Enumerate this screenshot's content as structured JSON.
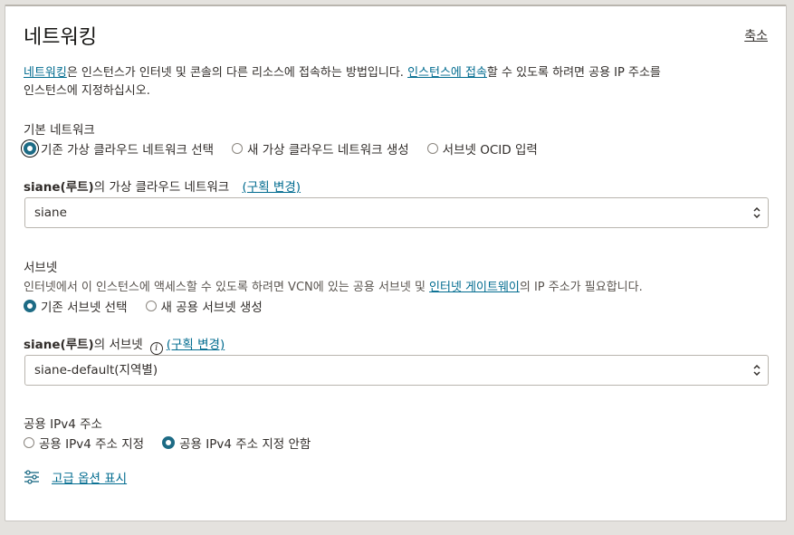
{
  "header": {
    "title": "네트워킹",
    "collapse_label": "축소"
  },
  "intro": {
    "link1": "네트워킹",
    "text1": "은 인스턴스가 인터넷 및 콘솔의 다른 리소스에 접속하는 방법입니다. ",
    "link2": "인스턴스에 접속",
    "text2": "할 수 있도록 하려면 공용 IP 주소를",
    "line2": "인스턴스에 지정하십시오."
  },
  "primary_network": {
    "label": "기본 네트워크",
    "options": [
      "기존 가상 클라우드 네트워크 선택",
      "새 가상 클라우드 네트워크 생성",
      "서브넷 OCID 입력"
    ],
    "selected": 0
  },
  "vcn": {
    "compartment": "siane(루트)",
    "label_suffix": "의 가상 클라우드 네트워크",
    "change_link": "(구획 변경)",
    "value": "siane"
  },
  "subnet_section": {
    "label": "서브넷",
    "help_text1": "인터넷에서 이 인스턴스에 액세스할 수 있도록 하려면 VCN에 있는 공용 서브넷 및 ",
    "help_link": "인터넷 게이트웨이",
    "help_text2": "의 IP 주소가 필요합니다.",
    "options": [
      "기존 서브넷 선택",
      "새 공용 서브넷 생성"
    ],
    "selected": 0
  },
  "subnet": {
    "compartment": "siane(루트)",
    "label_suffix": "의 서브넷",
    "info_icon": "i",
    "change_link": "(구획 변경)",
    "value": "siane-default(지역별)"
  },
  "public_ip": {
    "label": "공용 IPv4 주소",
    "options": [
      "공용 IPv4 주소 지정",
      "공용 IPv4 주소 지정 안함"
    ],
    "selected": 1
  },
  "advanced": {
    "icon": "sliders-icon",
    "label": "고급 옵션 표시"
  },
  "colors": {
    "accent": "#1d6b85",
    "link": "#006b8f"
  }
}
